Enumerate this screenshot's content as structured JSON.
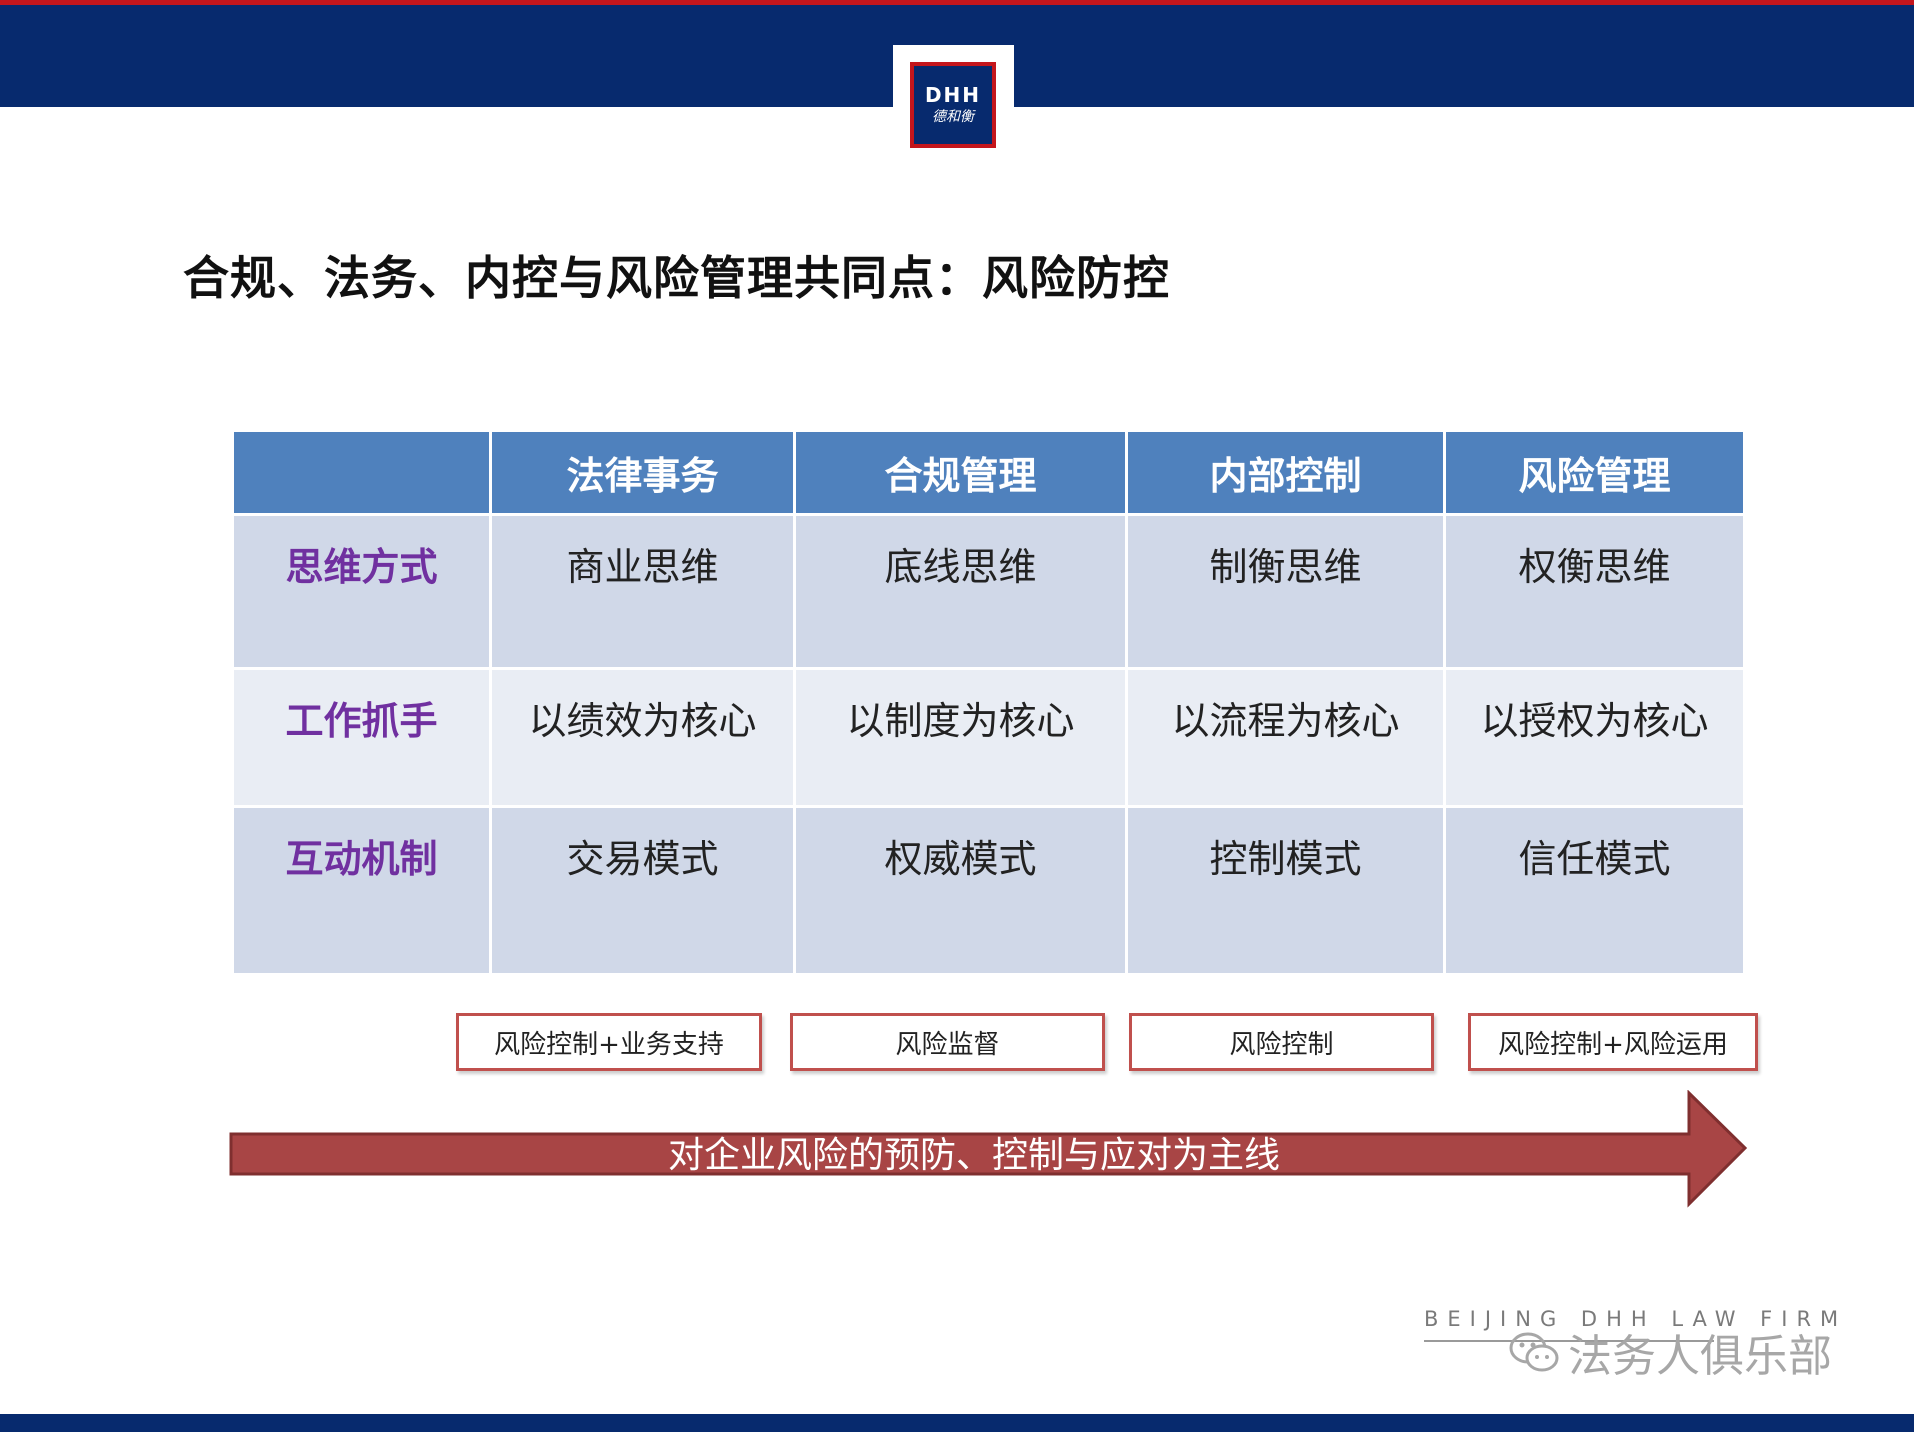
{
  "logo": {
    "letters": "DHH",
    "chars": "德和衡"
  },
  "title": "合规、法务、内控与风险管理共同点：风险防控",
  "table": {
    "headers": [
      "",
      "法律事务",
      "合规管理",
      "内部控制",
      "风险管理"
    ],
    "rows": [
      {
        "label": "思维方式",
        "cells": [
          "商业思维",
          "底线思维",
          "制衡思维",
          "权衡思维"
        ]
      },
      {
        "label": "工作抓手",
        "cells": [
          "以绩效为核心",
          "以制度为核心",
          "以流程为核心",
          "以授权为核心"
        ]
      },
      {
        "label": "互动机制",
        "cells": [
          "交易模式",
          "权威模式",
          "控制模式",
          "信任模式"
        ]
      }
    ]
  },
  "tags": [
    "风险控制+业务支持",
    "风险监督",
    "风险控制",
    "风险控制+风险运用"
  ],
  "arrow": {
    "label": "对企业风险的预防、控制与应对为主线",
    "color": "#a84545"
  },
  "footer": {
    "firm": "BEIJING DHH LAW FIRM",
    "watermark": "法务人俱乐部"
  },
  "colors": {
    "band": "#072a6e",
    "accent_red": "#c4161c",
    "header_blue": "#4f81bd",
    "row_label_purple": "#7030a0",
    "tag_border": "#c0504d"
  }
}
